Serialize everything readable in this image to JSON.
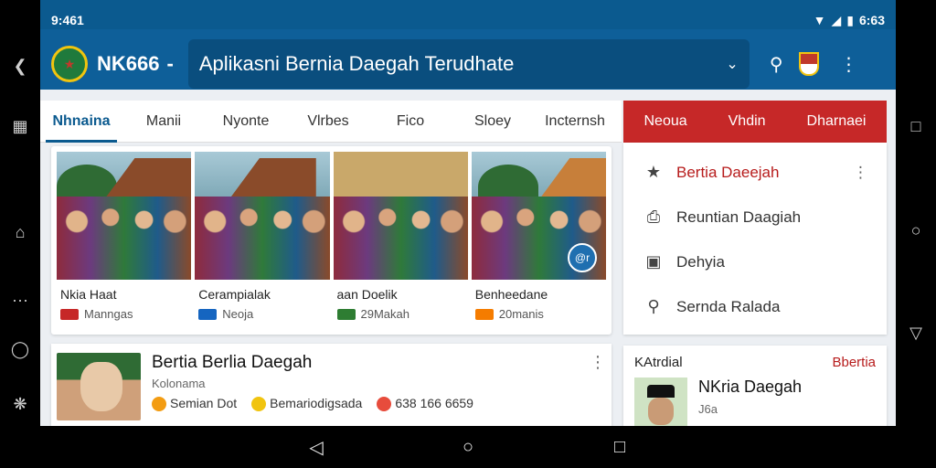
{
  "status": {
    "time": "9:461",
    "right": "6:63"
  },
  "app": {
    "brand": "NK666",
    "brand_dash": "-",
    "title": "Aplikasni Bernia Daegah Terudhate"
  },
  "tabs": [
    "Nhnaina",
    "Manii",
    "Nyonte",
    "Vlrbes",
    "Fico",
    "Sloey",
    "Incternsh"
  ],
  "red_tabs": [
    "Neoua",
    "Vhdin",
    "Dharnaei"
  ],
  "photo_cards": [
    {
      "caption": "Nkia Haat",
      "sub": "Manngas",
      "mini_color": "#c62828"
    },
    {
      "caption": "Cerampialak",
      "sub": "Neoja",
      "mini_color": "#1565c0"
    },
    {
      "caption": "aan Doelik",
      "sub": "29Makah",
      "mini_color": "#2e7d32"
    },
    {
      "caption": "Benheedane",
      "sub": "20manis",
      "mini_color": "#f57c00"
    }
  ],
  "photo_badge": "@r",
  "menu": [
    {
      "icon": "star-icon",
      "glyph": "★",
      "label": "Bertia Daeejah",
      "active": true
    },
    {
      "icon": "print-icon",
      "glyph": "⎙",
      "label": "Reuntian Daagiah",
      "active": false
    },
    {
      "icon": "briefcase-icon",
      "glyph": "▣",
      "label": "Dehyia",
      "active": false
    },
    {
      "icon": "search-icon",
      "glyph": "⚲",
      "label": "Sernda Ralada",
      "active": false
    }
  ],
  "article": {
    "title": "Bertia Berlia Daegah",
    "sub": "Kolonama",
    "meta": [
      {
        "text": "Semian Dot",
        "color": "#f39c12"
      },
      {
        "text": "Bemariodigsada",
        "color": "#f1c40f"
      },
      {
        "text": "638 166 6659",
        "color": "#e74c3c"
      }
    ]
  },
  "profile": {
    "label": "KAtrdial",
    "link": "Bbertia",
    "name": "NKria Daegah",
    "num": "J6a"
  },
  "colors": {
    "primary": "#0b5a8f",
    "accent_red": "#c62828"
  }
}
